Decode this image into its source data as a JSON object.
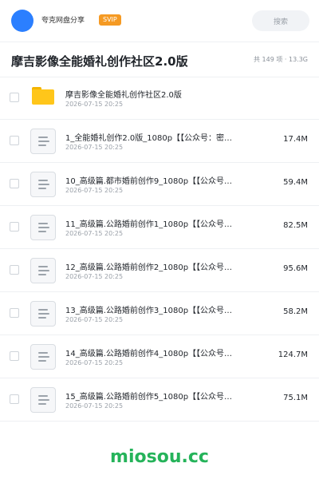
{
  "header": {
    "share_name": "夸克网盘分享",
    "badge": "SVIP",
    "search_placeholder": "搜索"
  },
  "title": {
    "text": "摩吉影像全能婚礼创作社区2.0版",
    "summary": "共 149 项 · 13.3G"
  },
  "items": [
    {
      "type": "folder",
      "name": "摩吉影像全能婚礼创作社区2.0版",
      "date": "2026-07-15 20:25",
      "size": ""
    },
    {
      "type": "file",
      "name": "1_全能婚礼创作2.0版_1080p【【公众号：密…",
      "date": "2026-07-15 20:25",
      "size": "17.4M"
    },
    {
      "type": "file",
      "name": "10_高级篇.都市婚前创作9_1080p【【公众号…",
      "date": "2026-07-15 20:25",
      "size": "59.4M"
    },
    {
      "type": "file",
      "name": "11_高级篇.公路婚前创作1_1080p【【公众号…",
      "date": "2026-07-15 20:25",
      "size": "82.5M"
    },
    {
      "type": "file",
      "name": "12_高级篇.公路婚前创作2_1080p【【公众号…",
      "date": "2026-07-15 20:25",
      "size": "95.6M"
    },
    {
      "type": "file",
      "name": "13_高级篇.公路婚前创作3_1080p【【公众号…",
      "date": "2026-07-15 20:25",
      "size": "58.2M"
    },
    {
      "type": "file",
      "name": "14_高级篇.公路婚前创作4_1080p【【公众号…",
      "date": "2026-07-15 20:25",
      "size": "124.7M"
    },
    {
      "type": "file",
      "name": "15_高级篇.公路婚前创作5_1080p【【公众号…",
      "date": "2026-07-15 20:25",
      "size": "75.1M"
    }
  ],
  "watermark": "miosou.cc",
  "colors": {
    "accent": "#2b7fff",
    "svip": "#f59a23",
    "folder": "#ffc61a",
    "watermark": "#25b35a"
  }
}
